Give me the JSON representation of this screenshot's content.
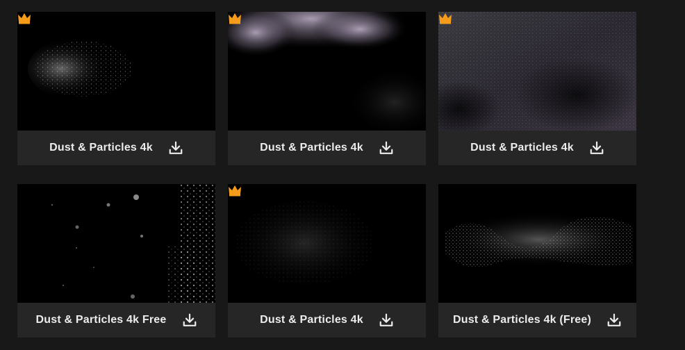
{
  "accent_premium": "#f59c1a",
  "items": [
    {
      "title": "Dust & Particles 4k",
      "premium": true,
      "icon": "download-icon"
    },
    {
      "title": "Dust & Particles 4k",
      "premium": true,
      "icon": "download-icon"
    },
    {
      "title": "Dust & Particles 4k",
      "premium": true,
      "icon": "download-icon"
    },
    {
      "title": "Dust & Particles 4k Free",
      "premium": false,
      "icon": "download-icon"
    },
    {
      "title": "Dust & Particles 4k",
      "premium": true,
      "icon": "download-icon"
    },
    {
      "title": "Dust & Particles 4k (Free)",
      "premium": false,
      "icon": "download-icon"
    }
  ]
}
